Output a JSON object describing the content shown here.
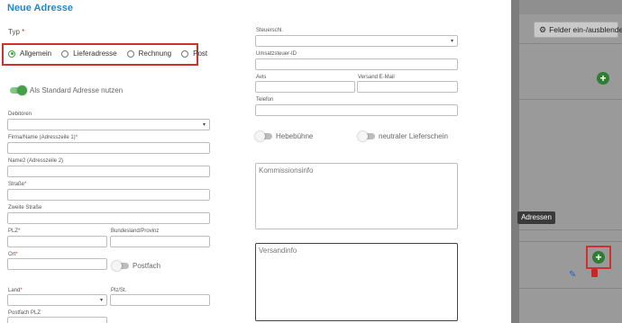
{
  "dialog": {
    "title": "Neue Adresse",
    "typ_label": "Typ",
    "typ_required": "*",
    "typ_options": [
      "Allgemein",
      "Lieferadresse",
      "Rechnung",
      "Post"
    ],
    "typ_selected": "Allgemein",
    "standard_toggle_label": "Als Standard Adresse nutzen",
    "standard_toggle_on": true
  },
  "left": {
    "debitoren_label": "Debitoren",
    "firma_label": "Firma/Name (Adresszeile 1)",
    "name2_label": "Name2 (Adresszeile 2)",
    "strasse_label": "Straße",
    "zweite_strasse_label": "Zweite Straße",
    "plz_label": "PLZ",
    "bundesland_label": "Bundesland/Provinz",
    "ort_label": "Ort",
    "postfach_label": "Postfach",
    "land_label": "Land",
    "plzst_label": "Plz/St.",
    "postfach_plz_label": "Postfach PLZ",
    "required_mark": "*"
  },
  "right": {
    "steuerschl_label": "Steuerschl.",
    "ust_label": "Umsatzsteuer-ID",
    "avis_label": "Avis",
    "versand_email_label": "Versand E-Mail",
    "telefon_label": "Telefon",
    "hebebuehne_label": "Hebebühne",
    "neutral_label": "neutraler Lieferschein",
    "kommission_placeholder": "Kommissionsinfo",
    "versand_placeholder": "Versandinfo"
  },
  "background": {
    "felder_button": "Felder ein-/ausblenden",
    "tooltip": "Adressen",
    "add_symbol": "+"
  },
  "colors": {
    "accent_blue": "#1e88c8",
    "green": "#43a047",
    "highlight_red": "#d32f2f"
  }
}
